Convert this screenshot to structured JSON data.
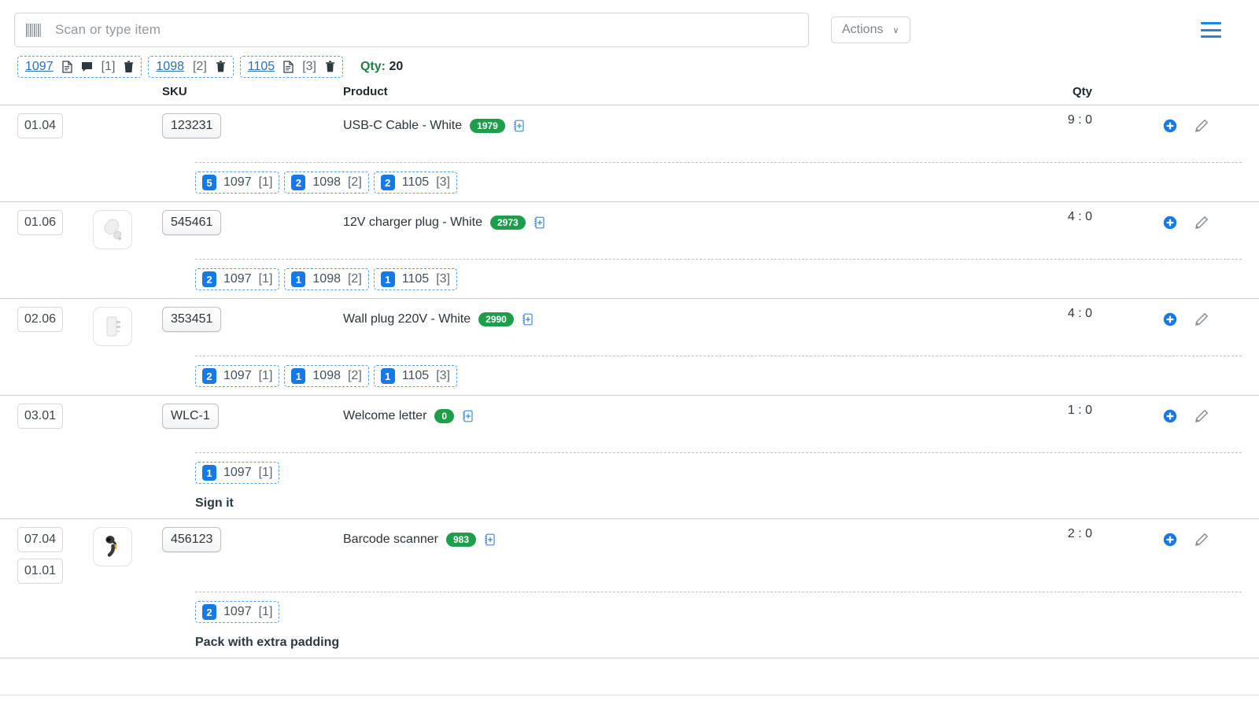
{
  "toolbar": {
    "scan_placeholder": "Scan or type item",
    "barcode_icon": "barcode-icon",
    "actions_label": "Actions",
    "actions_caret": "∨",
    "menu_icon": "hamburger-menu-icon"
  },
  "orders": {
    "chips": [
      {
        "id": "1097",
        "doc_icon": "document-icon",
        "chat_icon": "comment-icon",
        "bracket": "[1]",
        "trash_icon": "trash-icon",
        "has_chat": true,
        "has_doc": true
      },
      {
        "id": "1098",
        "doc_icon": "",
        "chat_icon": "",
        "bracket": "[2]",
        "trash_icon": "trash-icon",
        "has_chat": false,
        "has_doc": false
      },
      {
        "id": "1105",
        "doc_icon": "document-icon",
        "chat_icon": "",
        "bracket": "[3]",
        "trash_icon": "trash-icon",
        "has_chat": false,
        "has_doc": true
      }
    ],
    "qty_label": "Qty:",
    "qty_value": "20"
  },
  "table": {
    "headers": {
      "pos": "",
      "image": "",
      "sku": "SKU",
      "product": "Product",
      "qty": "Qty",
      "actions": ""
    },
    "rows": [
      {
        "positions": [
          "01.04"
        ],
        "thumb": "",
        "sku": "123231",
        "product": "USB-C Cable - White",
        "badge": "1979",
        "note_icon": "add-note-icon",
        "qty": "9 : 0",
        "add_icon": "add-circle-icon",
        "edit_icon": "pencil-icon",
        "allocations": [
          {
            "count": "5",
            "order": "1097",
            "bracket": "[1]"
          },
          {
            "count": "2",
            "order": "1098",
            "bracket": "[2]"
          },
          {
            "count": "2",
            "order": "1105",
            "bracket": "[3]"
          }
        ],
        "note": ""
      },
      {
        "positions": [
          "01.06"
        ],
        "thumb": "charger-plug",
        "sku": "545461",
        "product": "12V charger plug - White",
        "badge": "2973",
        "note_icon": "add-note-icon",
        "qty": "4 : 0",
        "add_icon": "add-circle-icon",
        "edit_icon": "pencil-icon",
        "allocations": [
          {
            "count": "2",
            "order": "1097",
            "bracket": "[1]"
          },
          {
            "count": "1",
            "order": "1098",
            "bracket": "[2]"
          },
          {
            "count": "1",
            "order": "1105",
            "bracket": "[3]"
          }
        ],
        "note": ""
      },
      {
        "positions": [
          "02.06"
        ],
        "thumb": "wall-plug",
        "sku": "353451",
        "product": "Wall plug 220V - White",
        "badge": "2990",
        "note_icon": "add-note-icon",
        "qty": "4 : 0",
        "add_icon": "add-circle-icon",
        "edit_icon": "pencil-icon",
        "allocations": [
          {
            "count": "2",
            "order": "1097",
            "bracket": "[1]"
          },
          {
            "count": "1",
            "order": "1098",
            "bracket": "[2]"
          },
          {
            "count": "1",
            "order": "1105",
            "bracket": "[3]"
          }
        ],
        "note": ""
      },
      {
        "positions": [
          "03.01"
        ],
        "thumb": "",
        "sku": "WLC-1",
        "product": "Welcome letter",
        "badge": "0",
        "note_icon": "add-note-icon",
        "qty": "1 : 0",
        "add_icon": "add-circle-icon",
        "edit_icon": "pencil-icon",
        "allocations": [
          {
            "count": "1",
            "order": "1097",
            "bracket": "[1]"
          }
        ],
        "note": "Sign it"
      },
      {
        "positions": [
          "07.04",
          "01.01"
        ],
        "thumb": "barcode-scanner",
        "sku": "456123",
        "product": "Barcode scanner",
        "badge": "983",
        "note_icon": "add-note-icon",
        "qty": "2 : 0",
        "add_icon": "add-circle-icon",
        "edit_icon": "pencil-icon",
        "allocations": [
          {
            "count": "2",
            "order": "1097",
            "bracket": "[1]"
          }
        ],
        "note": "Pack with extra padding"
      }
    ]
  },
  "colors": {
    "accent_blue": "#1779e8",
    "link_blue": "#2b6fb5",
    "badge_green": "#1c9e4b",
    "qty_green": "#1e7e45",
    "menu_blue": "#1d88e5"
  }
}
